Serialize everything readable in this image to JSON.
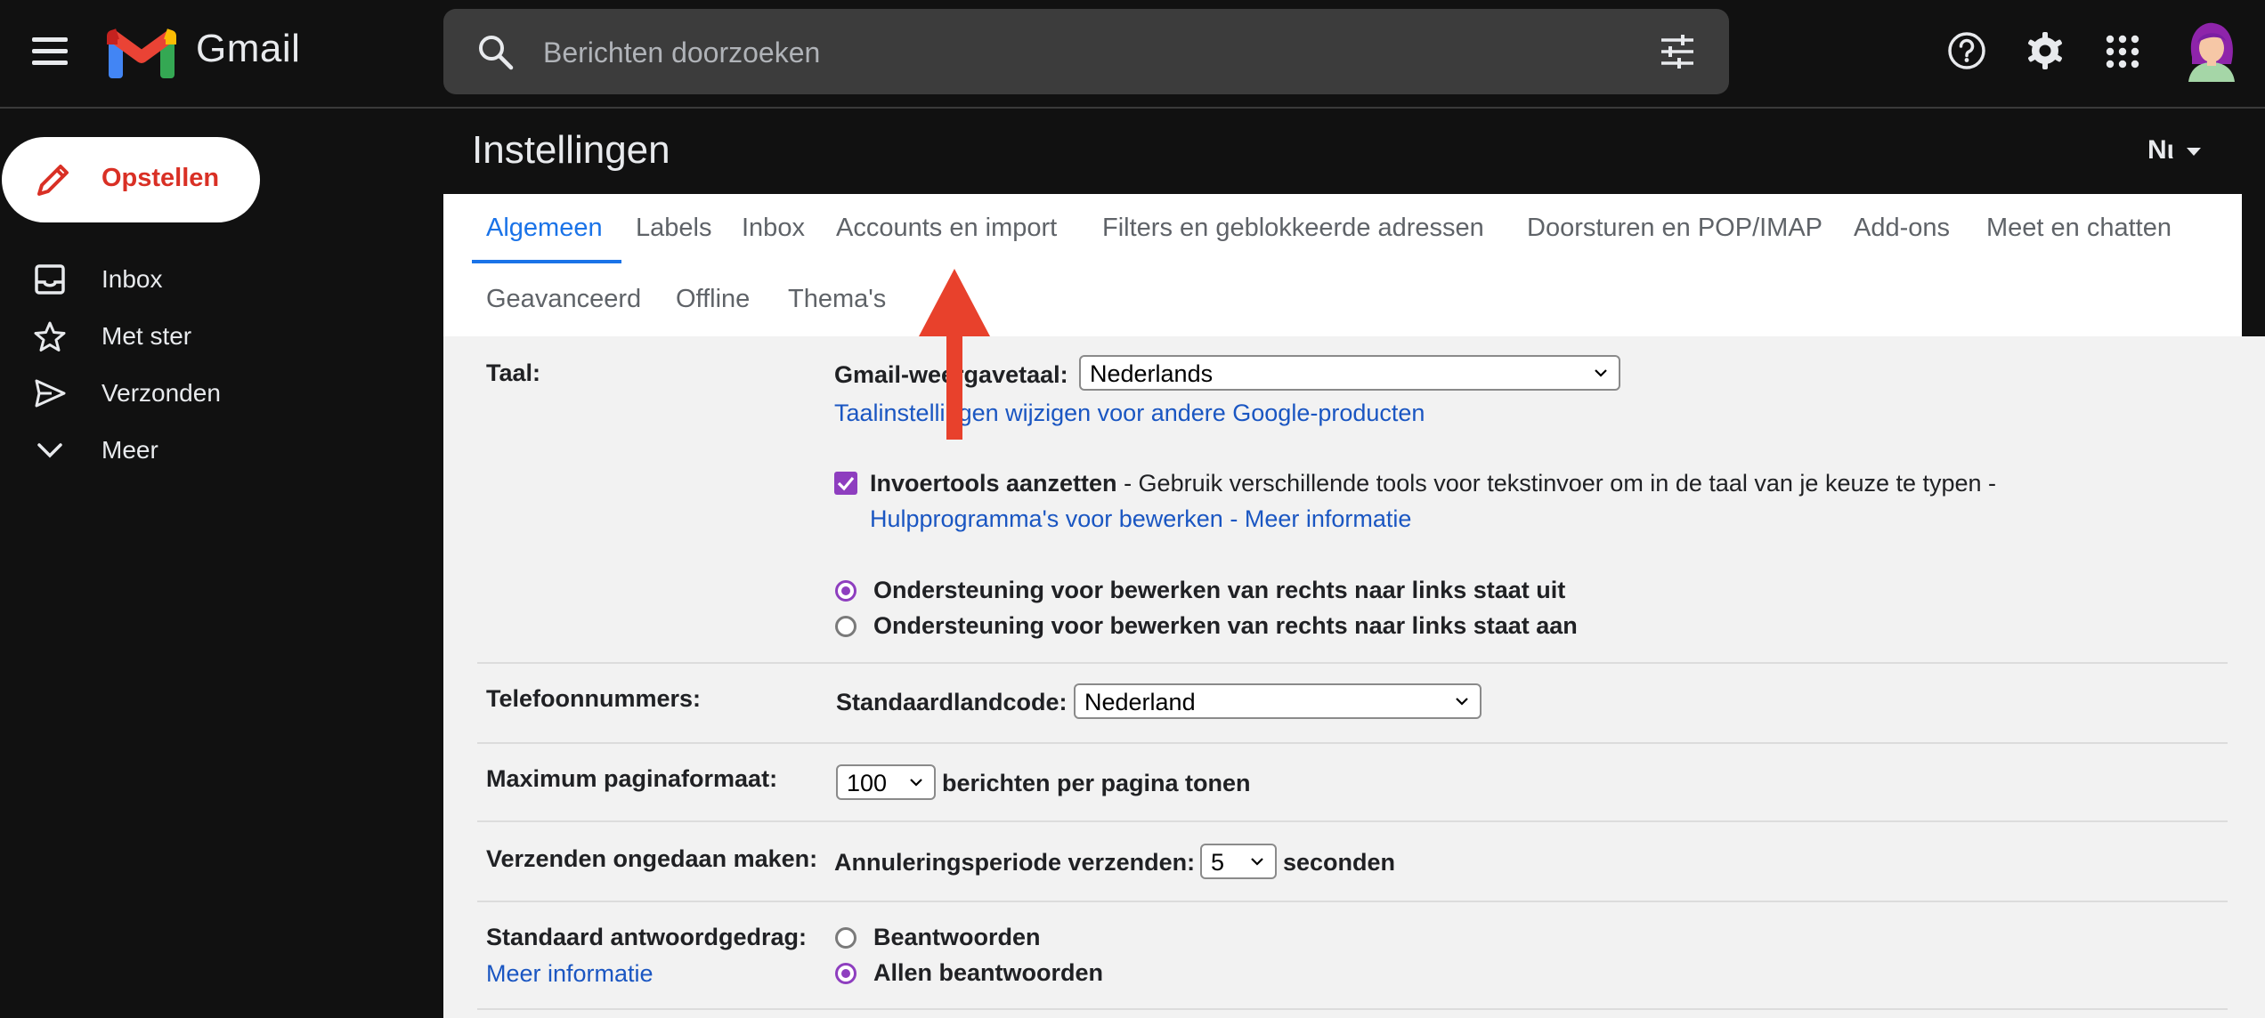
{
  "app": {
    "name": "Gmail"
  },
  "search": {
    "placeholder": "Berichten doorzoeken"
  },
  "sidebar": {
    "compose_label": "Opstellen",
    "items": [
      {
        "label": "Inbox",
        "icon": "inbox-icon"
      },
      {
        "label": "Met ster",
        "icon": "star-icon"
      },
      {
        "label": "Verzonden",
        "icon": "send-icon"
      },
      {
        "label": "Meer",
        "icon": "chevron-down-icon"
      }
    ]
  },
  "header": {
    "title": "Instellingen",
    "input_lang": "Nι"
  },
  "tabs": [
    {
      "label": "Algemeen",
      "active": true
    },
    {
      "label": "Labels"
    },
    {
      "label": "Inbox"
    },
    {
      "label": "Accounts en import"
    },
    {
      "label": "Filters en geblokkeerde adressen"
    },
    {
      "label": "Doorsturen en POP/IMAP"
    },
    {
      "label": "Add-ons"
    },
    {
      "label": "Meet en chatten"
    },
    {
      "label": "Geavanceerd"
    },
    {
      "label": "Offline"
    },
    {
      "label": "Thema's"
    }
  ],
  "settings": {
    "taal": {
      "label": "Taal:",
      "display_lang_label": "Gmail-weergavetaal:",
      "display_lang_value": "Nederlands",
      "lang_link": "Taalinstellingen wijzigen voor andere Google-producten",
      "input_tools_bold": "Invoertools aanzetten",
      "input_tools_desc": " - Gebruik verschillende tools voor tekstinvoer om in de taal van je keuze te typen -",
      "edit_tools_link": "Hulpprogramma's voor bewerken",
      "dash": " - ",
      "more_info_link": "Meer informatie",
      "rtl_off": "Ondersteuning voor bewerken van rechts naar links staat uit",
      "rtl_on": "Ondersteuning voor bewerken van rechts naar links staat aan"
    },
    "phone": {
      "label": "Telefoonnummers:",
      "country_code_label": "Standaardlandcode:",
      "country_code_value": "Nederland"
    },
    "page_size": {
      "label": "Maximum paginaformaat:",
      "value": "100",
      "suffix": "berichten per pagina tonen"
    },
    "undo_send": {
      "label": "Verzenden ongedaan maken:",
      "period_label": "Annuleringsperiode verzenden:",
      "value": "5",
      "suffix": "seconden"
    },
    "reply": {
      "label": "Standaard antwoordgedrag:",
      "more_info": "Meer informatie",
      "option_reply": "Beantwoorden",
      "option_reply_all": "Allen beantwoorden"
    }
  },
  "colors": {
    "accent": "#1a73e8",
    "checkbox": "#8e3ebf",
    "compose_text": "#d93025",
    "annotation_arrow": "#e8412c"
  }
}
